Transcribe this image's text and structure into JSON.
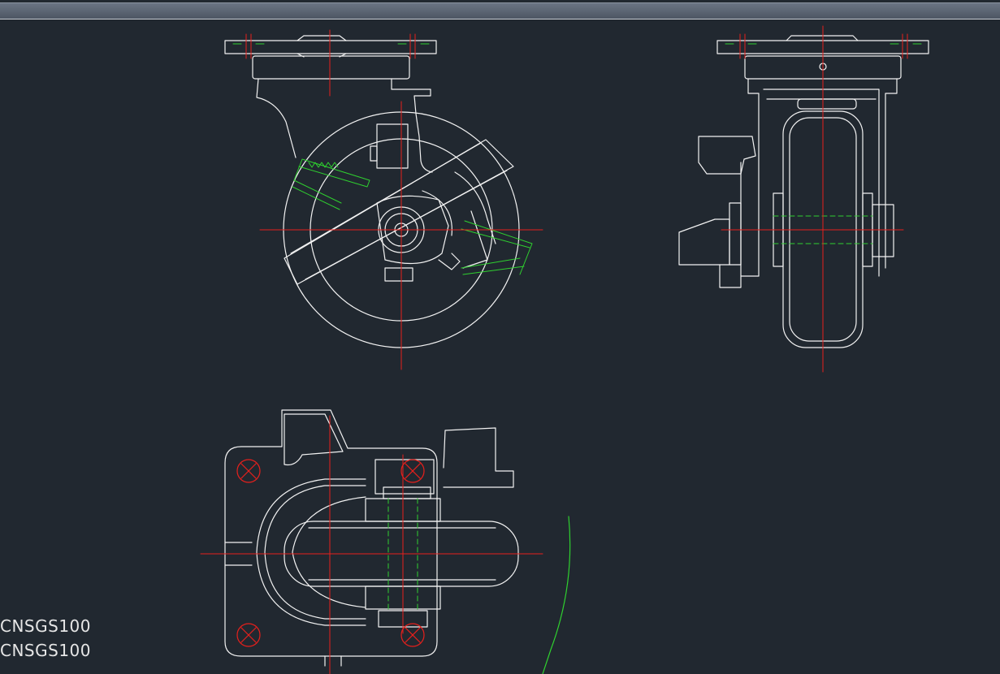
{
  "drawing": {
    "labels": [
      "CNSGS100",
      "CNSGS100"
    ]
  },
  "colors": {
    "background": "#212830",
    "linework": "#f2f2f2",
    "centerline": "#e8201c",
    "hatch": "#2fd12f",
    "bolt_mark": "#e8201c"
  }
}
